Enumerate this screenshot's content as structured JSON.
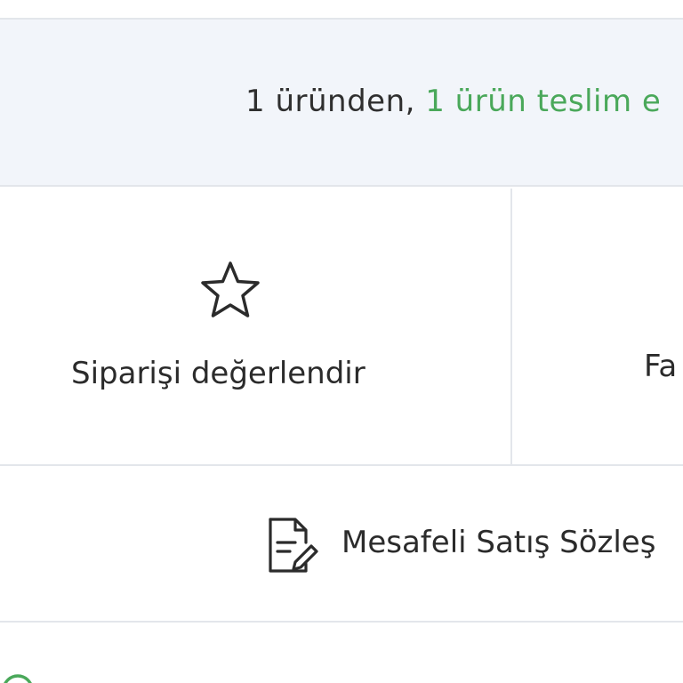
{
  "summary": {
    "prefix": "1 üründen, ",
    "highlight": "1 ürün teslim e",
    "highlight_color": "#4aa85a"
  },
  "actions": {
    "rate_order_label": "Siparişi değerlendir",
    "rate_order_icon": "star-outline-icon",
    "invoice_label": "Fa"
  },
  "contract": {
    "label": "Mesafeli Satış Sözleş",
    "icon": "document-edit-icon"
  },
  "bottom": {
    "icon": "circle-icon",
    "label": ""
  }
}
